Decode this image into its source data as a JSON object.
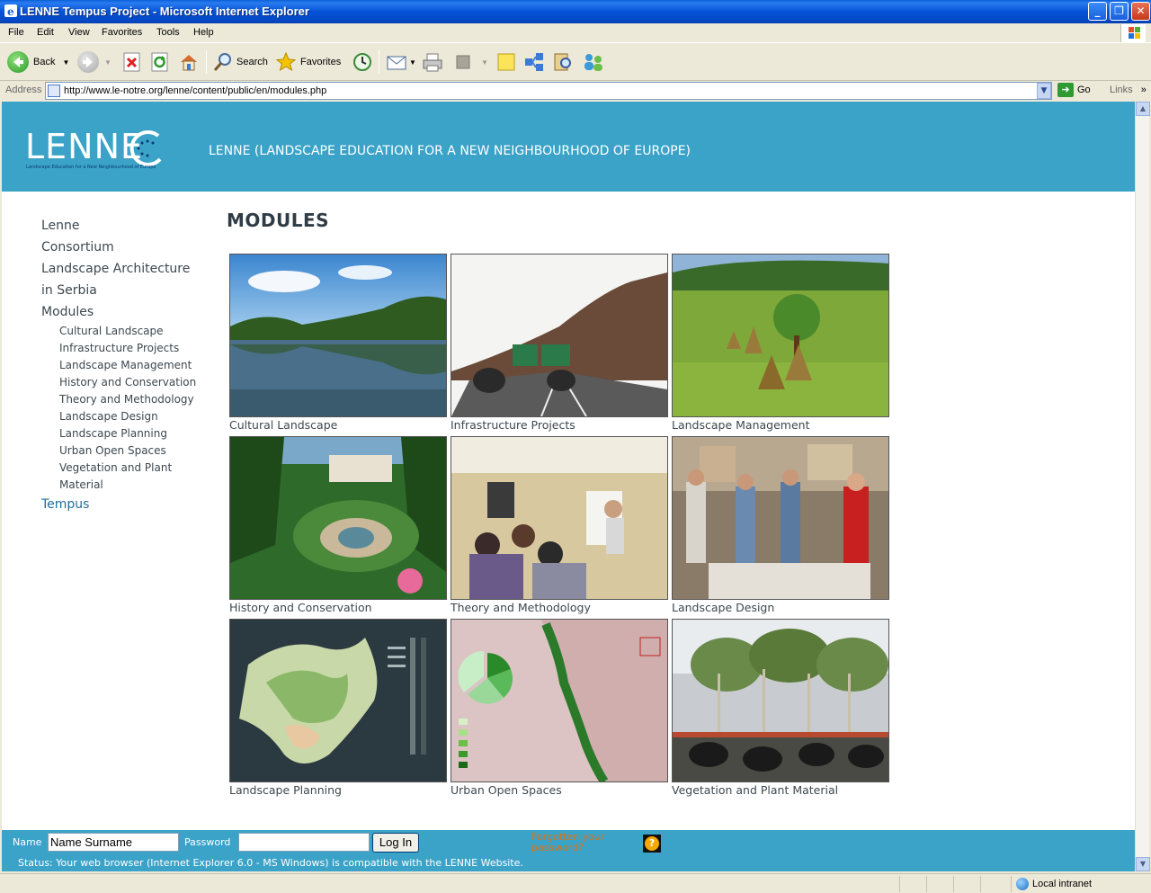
{
  "window": {
    "title": "LENNE Tempus Project - Microsoft Internet Explorer",
    "controls": [
      "_",
      "❐",
      "✕"
    ]
  },
  "menu": [
    "File",
    "Edit",
    "View",
    "Favorites",
    "Tools",
    "Help"
  ],
  "toolbar": {
    "back_label": "Back",
    "search_label": "Search",
    "favorites_label": "Favorites"
  },
  "address": {
    "label": "Address",
    "url": "http://www.le-notre.org/lenne/content/public/en/modules.php",
    "go_label": "Go",
    "links_label": "Links"
  },
  "site": {
    "logo_text": "LENNE",
    "logo_tagline": "Landscape Education for a New Neighbourhood of Europe",
    "title": "LENNE (LANDSCAPE EDUCATION FOR A NEW NEIGHBOURHOOD OF EUROPE)"
  },
  "nav": {
    "top": [
      "Lenne",
      "Consortium",
      "Landscape Architecture",
      "in Serbia",
      "Modules"
    ],
    "modules": [
      "Cultural Landscape",
      "Infrastructure Projects",
      "Landscape Management",
      "History and Conservation",
      "Theory and Methodology",
      "Landscape Design",
      "Landscape Planning",
      "Urban Open Spaces",
      "Vegetation and Plant",
      "Material"
    ],
    "bottom": "Tempus"
  },
  "page": {
    "heading": "MODULES",
    "modules": [
      {
        "caption": "Cultural Landscape"
      },
      {
        "caption": "Infrastructure Projects"
      },
      {
        "caption": "Landscape Management"
      },
      {
        "caption": "History and Conservation"
      },
      {
        "caption": "Theory and Methodology"
      },
      {
        "caption": "Landscape Design"
      },
      {
        "caption": "Landscape Planning"
      },
      {
        "caption": "Urban Open Spaces"
      },
      {
        "caption": "Vegetation and Plant Material"
      }
    ]
  },
  "login": {
    "name_label": "Name",
    "name_value": "Name Surname",
    "password_label": "Password",
    "password_value": "",
    "button_label": "Log In",
    "forgot_label": "Forgotten your password?",
    "help_icon": "?",
    "status": "Status: Your web browser (Internet Explorer 6.0 - MS Windows) is compatible with the LENNE Website."
  },
  "statusbar": {
    "zone": "Local intranet"
  },
  "colors": {
    "header": "#3ba3c8",
    "nav_text": "#3d4850",
    "accent": "#1f6f9a",
    "forgot": "#e07010"
  }
}
